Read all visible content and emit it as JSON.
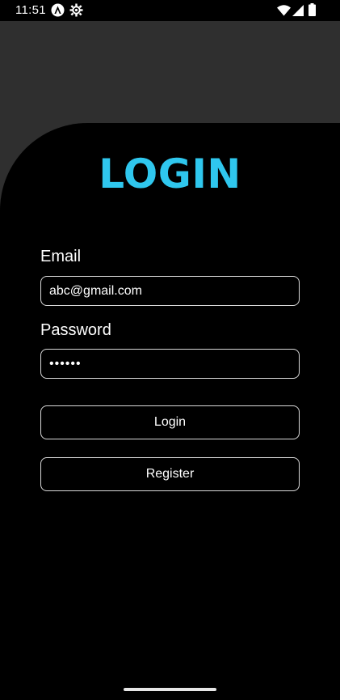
{
  "status_bar": {
    "time": "11:51",
    "icons": [
      "app-a-icon",
      "settings-gear-icon",
      "wifi-icon",
      "cell-signal-icon",
      "battery-icon"
    ]
  },
  "login": {
    "title": "LOGIN",
    "email_label": "Email",
    "email_value": "abc@gmail.com",
    "password_label": "Password",
    "password_value": "••••••",
    "login_button": "Login",
    "register_button": "Register"
  },
  "colors": {
    "accent": "#2fc7ee",
    "background": "#000000",
    "header_bg": "#2f2f2f",
    "border": "#d9d9d9"
  }
}
